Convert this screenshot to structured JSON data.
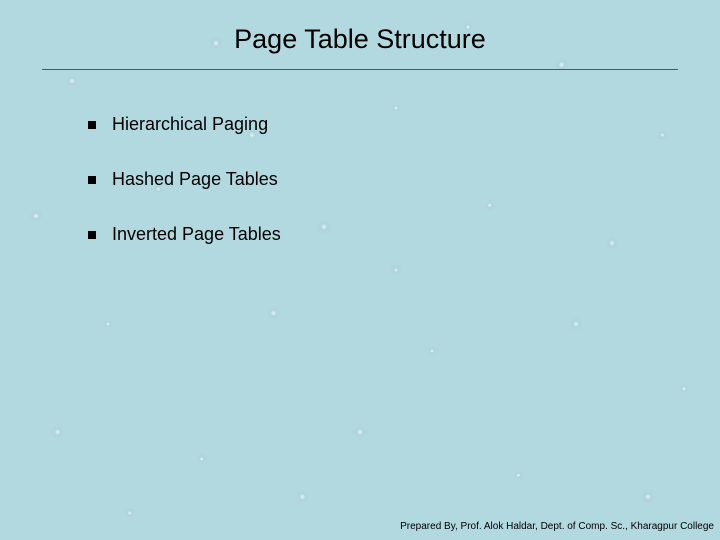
{
  "title": "Page Table Structure",
  "bullets": [
    {
      "text": "Hierarchical Paging"
    },
    {
      "text": "Hashed Page Tables"
    },
    {
      "text": "Inverted Page Tables"
    }
  ],
  "footer": "Prepared By, Prof. Alok Haldar, Dept. of Comp. Sc., Kharagpur College"
}
